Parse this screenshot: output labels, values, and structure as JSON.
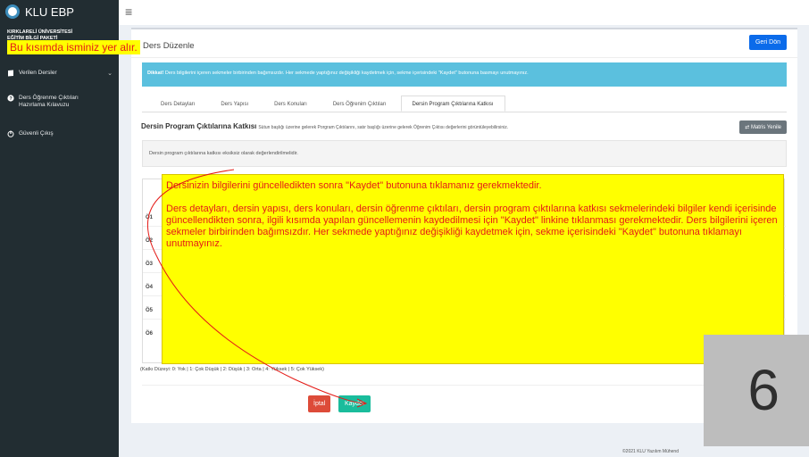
{
  "app": {
    "brand": "KLU EBP",
    "university_line1": "KIRKLARELİ ÜNİVERSİTESİ",
    "university_line2": "EĞİTİM BİLGİ PAKETİ"
  },
  "sidebar": {
    "items": [
      {
        "label": "Verilen Dersler",
        "icon": "book-icon"
      },
      {
        "label_line1": "Ders Öğrenme Çıktıları",
        "label_line2": "Hazırlama Kılavuzu",
        "icon": "question-circle-icon"
      },
      {
        "label": "Güvenli Çıkış",
        "icon": "power-icon"
      }
    ]
  },
  "page": {
    "title": "Ders Düzenle",
    "back_button": "Geri Dön"
  },
  "alert": {
    "strong": "Dikkat!",
    "text": " Ders bilgilerini içeren sekmeler birbirinden bağımsızdır. Her sekmede yaptığınız değişikliği kaydetmek için, sekme içerisindeki \"Kaydet\" butonuna basmayı unutmayınız."
  },
  "tabs": [
    {
      "label": "Ders Detayları",
      "active": false
    },
    {
      "label": "Ders Yapısı",
      "active": false
    },
    {
      "label": "Ders Konuları",
      "active": false
    },
    {
      "label": "Ders Öğrenim Çıktıları",
      "active": false
    },
    {
      "label": "Dersin Program Çıktılarına Katkısı",
      "active": true
    }
  ],
  "section": {
    "title": "Dersin Program Çıktılarına Katkısı",
    "description": "Sütun başlığı üzerine gelerek Porgram Çıktılarını, satır başlığı üzerine gelerek Öğrenim Çıktısı değerlerini görüntüleyebilirsiniz.",
    "refresh_button": "Matris Yenile",
    "note": "Dersin program çıktılarına katkısı eksiksiz olarak değerlendirilmelidir."
  },
  "matrix": {
    "rows": [
      "Ö1",
      "Ö2",
      "Ö3",
      "Ö4",
      "Ö5",
      "Ö6"
    ]
  },
  "legend": "(Katkı Düzeyi: 0: Yok | 1: Çok Düşük | 2: Düşük | 3: Orta | 4: Yüksek | 5: Çok Yüksek)",
  "actions": {
    "cancel": "İptal",
    "save": "Kaydet"
  },
  "footer": "©2021 KLU Yazılım Mühend",
  "annotations": {
    "name_tip": "Bu kısımda isminiz yer alır.",
    "note_p1": "Dersinizin bilgilerini güncelledikten sonra \"Kaydet\" butonuna tıklamanız gerekmektedir.",
    "note_p2": "Ders detayları, dersin yapısı, ders konuları, dersin öğrenme çıktıları, dersin program çıktılarına katkısı sekmelerindeki bilgiler kendi içerisinde güncellendikten sonra, ilgili kısımda yapılan güncellemenin kaydedilmesi için \"Kaydet\" linkine tıklanması gerekmektedir. Ders bilgilerini içeren sekmeler birbirinden bağımsızdır. Her sekmede yaptığınız değişikliği kaydetmek için, sekme içerisindeki \"Kaydet\" butonuna tıklamayı unutmayınız.",
    "step_number": "6",
    "highlight_color": "#ffff00",
    "text_color": "#e41b17"
  },
  "colors": {
    "sidebar": "#222d32",
    "primary": "#0b6bea",
    "info": "#5bc0de",
    "danger": "#dd4b39",
    "success": "#1abc9c"
  }
}
